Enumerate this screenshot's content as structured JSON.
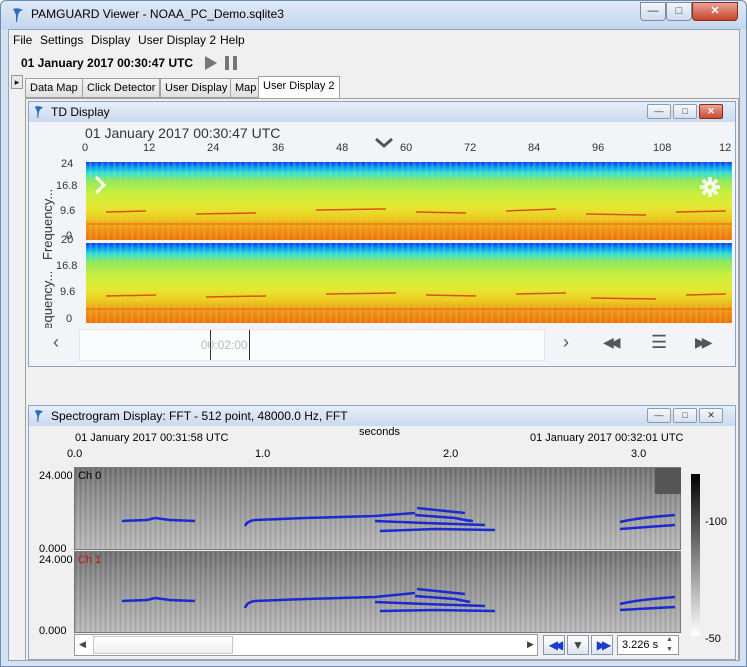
{
  "window": {
    "title": "PAMGUARD Viewer - NOAA_PC_Demo.sqlite3"
  },
  "menu": [
    "File",
    "Settings",
    "Display",
    "User Display 2",
    "Help"
  ],
  "toolbar": {
    "datetime": "01 January 2017 00:30:47 UTC"
  },
  "tabs": [
    "Data Map",
    "Click Detector",
    "User Display",
    "Map",
    "User Display 2"
  ],
  "td_display": {
    "title": "TD Display",
    "datetime": "01 January 2017 00:30:47 UTC",
    "x_ticks": [
      "0",
      "12",
      "24",
      "36",
      "48",
      "60",
      "72",
      "84",
      "96",
      "108",
      "12"
    ],
    "y_label": "Frequency...",
    "y_ticks_top": [
      "24",
      "16.8",
      "9.6",
      "0"
    ],
    "y_ticks_bottom": [
      "20",
      "16.8",
      "9.6",
      "0"
    ],
    "scroll_time": "00:02:00"
  },
  "spectrogram": {
    "title": "Spectrogram Display: FFT - 512 point, 48000.0 Hz, FFT",
    "start_time": "01 January 2017 00:31:58 UTC",
    "end_time": "01 January 2017 00:32:01 UTC",
    "x_label": "seconds",
    "x_ticks": [
      "0.0",
      "1.0",
      "2.0",
      "3.0"
    ],
    "ch0": {
      "label": "Ch 0",
      "ymax": "24.000",
      "ymin": "0.000"
    },
    "ch1": {
      "label": "Ch 1",
      "ymax": "24.000",
      "ymin": "0.000"
    },
    "colorbar": [
      "-100",
      "-50"
    ],
    "duration": "3.226 s"
  },
  "colors": {
    "accent_blue": "#1a3cc8",
    "ch0": "#0000ff",
    "ch1": "#ff0000"
  }
}
